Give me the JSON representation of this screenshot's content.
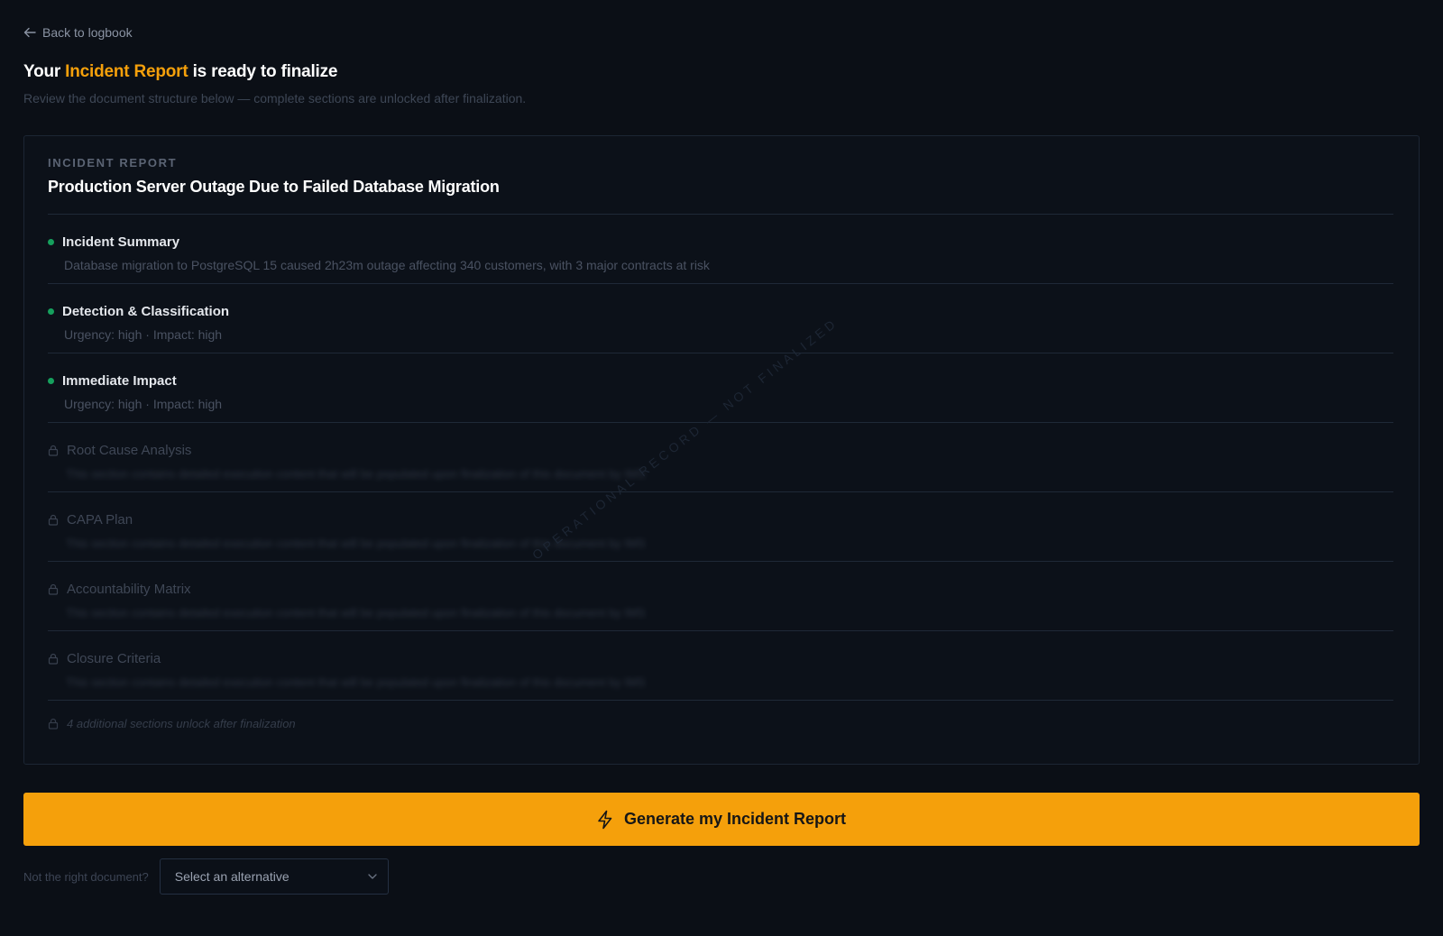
{
  "nav": {
    "back_label": "Back to logbook"
  },
  "header": {
    "title_prefix": "Your ",
    "title_accent": "Incident Report",
    "title_suffix": " is ready to finalize",
    "subtitle": "Review the document structure below — complete sections are unlocked after finalization."
  },
  "document": {
    "kicker": "INCIDENT REPORT",
    "title": "Production Server Outage Due to Failed Database Migration",
    "watermark": "OPERATIONAL RECORD — NOT FINALIZED",
    "sections": [
      {
        "name": "Incident Summary",
        "status": "complete",
        "description": "Database migration to PostgreSQL 15 caused 2h23m outage affecting 340 customers, with 3 major contracts at risk"
      },
      {
        "name": "Detection & Classification",
        "status": "complete",
        "description": "Urgency: high · Impact: high"
      },
      {
        "name": "Immediate Impact",
        "status": "complete",
        "description": "Urgency: high · Impact: high"
      },
      {
        "name": "Root Cause Analysis",
        "status": "locked",
        "description": "This section contains detailed execution content that will be populated upon finalization of this document by IMS"
      },
      {
        "name": "CAPA Plan",
        "status": "locked",
        "description": "This section contains detailed execution content that will be populated upon finalization of this document by IMS"
      },
      {
        "name": "Accountability Matrix",
        "status": "locked",
        "description": "This section contains detailed execution content that will be populated upon finalization of this document by IMS"
      },
      {
        "name": "Closure Criteria",
        "status": "locked",
        "description": "This section contains detailed execution content that will be populated upon finalization of this document by IMS"
      }
    ],
    "more_sections_note": "4 additional sections unlock after finalization"
  },
  "cta": {
    "label": "Generate my Incident Report"
  },
  "alternative": {
    "prompt": "Not the right document?",
    "placeholder": "Select an alternative"
  },
  "colors": {
    "accent": "#f5a00b",
    "complete_dot": "#16a05d",
    "background": "#0b0f16"
  }
}
